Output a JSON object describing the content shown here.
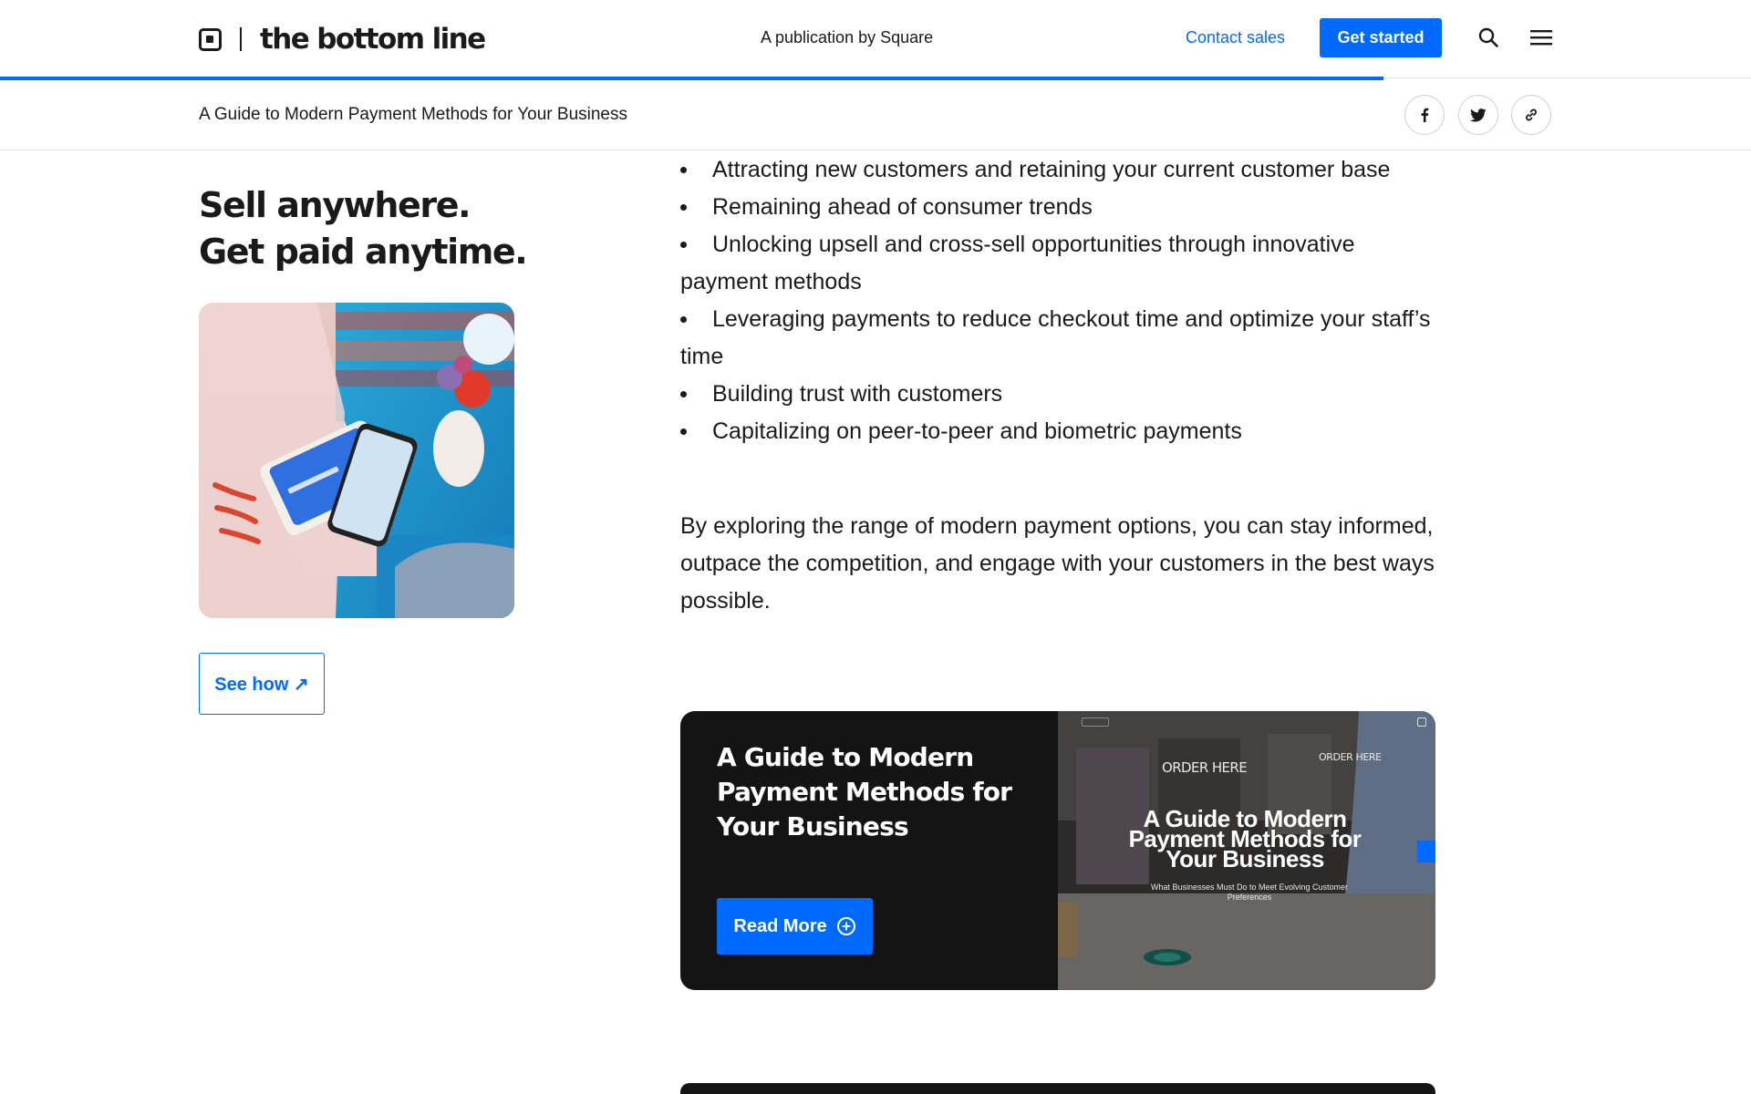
{
  "header": {
    "logo_text": "the bottom line",
    "publication": "A publication by Square",
    "contact_label": "Contact sales",
    "cta_label": "Get started",
    "read_progress_percent": 79
  },
  "subheader": {
    "title": "A Guide to Modern Payment Methods for Your Business",
    "share_icons": [
      "facebook-icon",
      "twitter-icon",
      "link-icon"
    ]
  },
  "promo": {
    "title": "Sell anywhere. Get paid anytime.",
    "button_label": "See how ↗"
  },
  "article": {
    "bullets": [
      "Attracting new customers and retaining your current customer base",
      "Remaining ahead of consumer trends",
      "Unlocking upsell and cross-sell opportunities through innovative payment methods",
      "Leveraging payments to reduce checkout time and optimize your staff’s time",
      "Building trust with customers",
      "Capitalizing on peer-to-peer and biometric payments"
    ],
    "paragraph": "By exploring the range of modern payment options, you can stay informed, outpace the competition, and engage with your customers in the best ways possible."
  },
  "card": {
    "title": "A Guide to Modern Payment Methods for Your Business",
    "button_label": "Read More",
    "media_title": "A Guide to Modern Payment Methods for Your Business",
    "media_subtitle": "What Businesses Must Do to Meet Evolving Customer Preferences",
    "media_signs": [
      "ORDER HERE",
      "ORDER HERE"
    ]
  },
  "colors": {
    "accent": "#006aff",
    "text": "#1a1a1a",
    "card_bg": "#141414"
  }
}
